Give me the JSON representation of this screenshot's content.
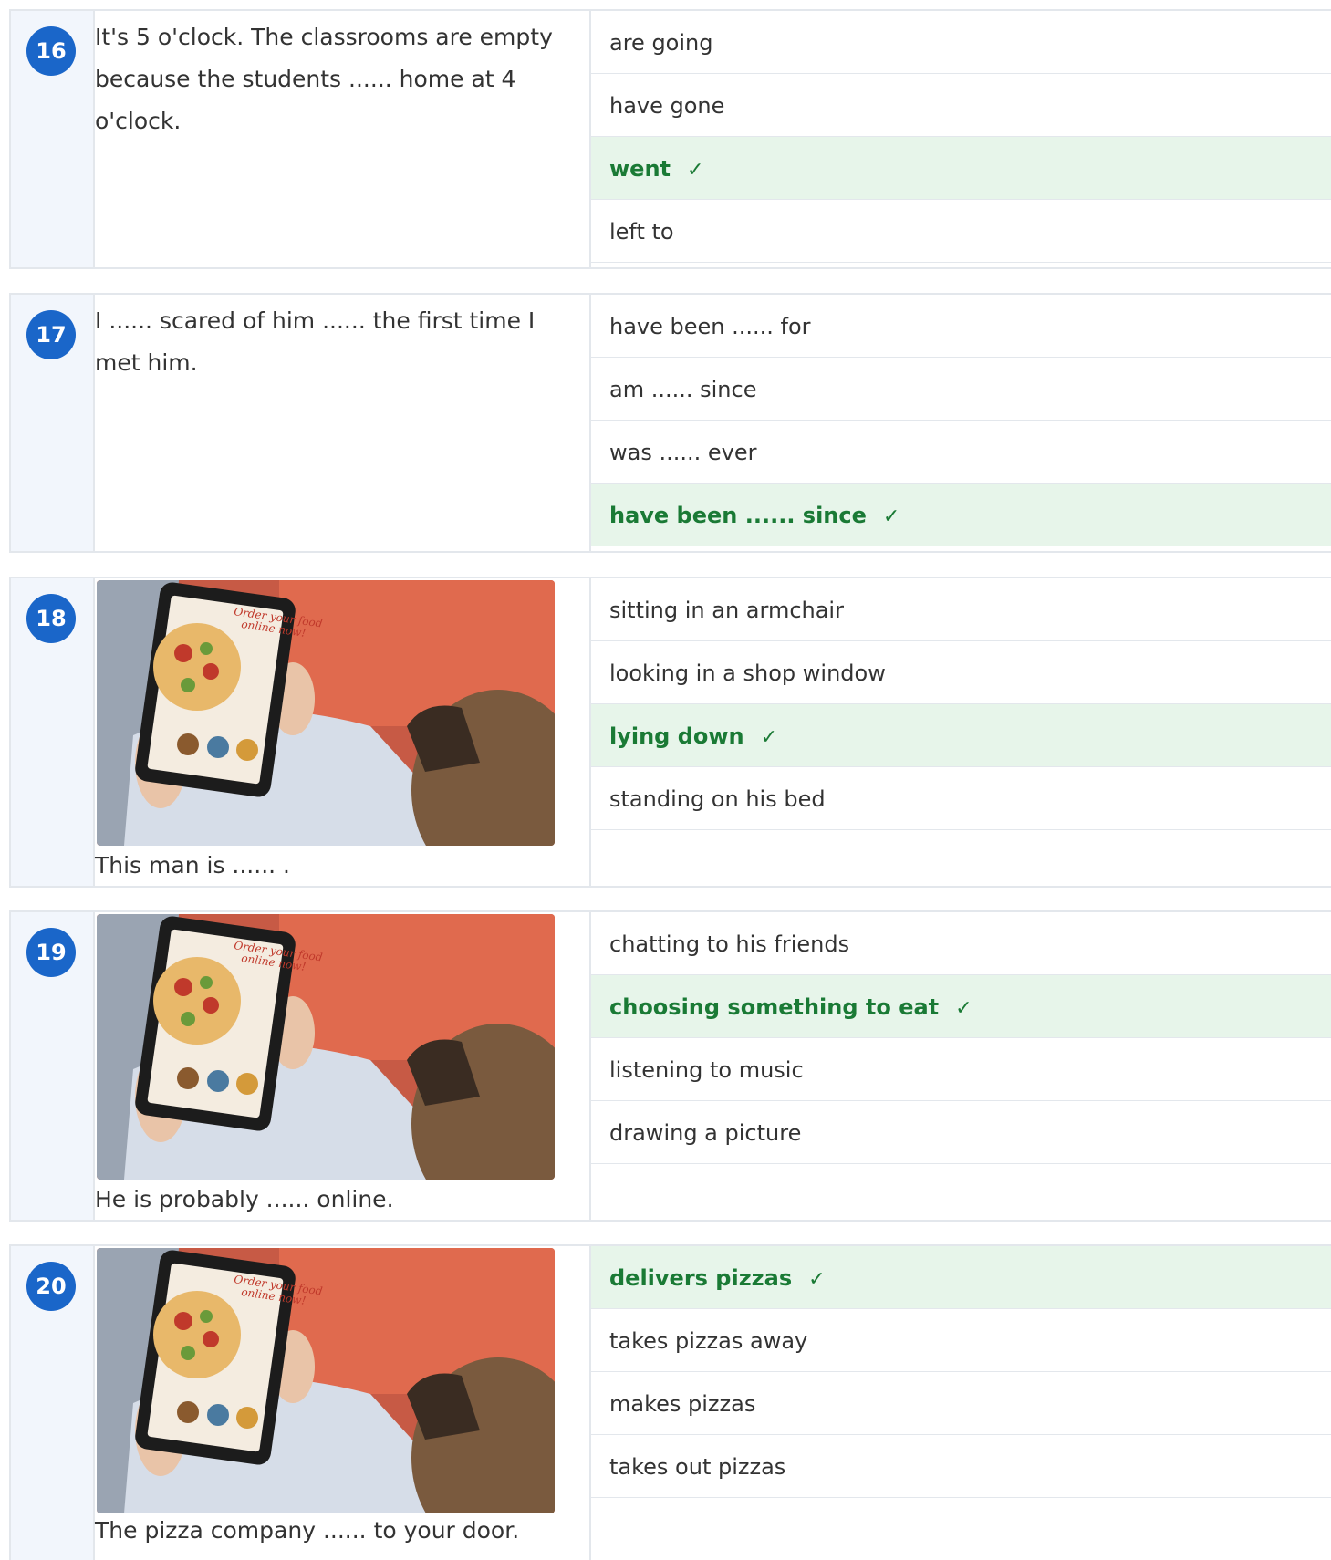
{
  "questions": [
    {
      "number": "16",
      "prompt": "It's 5 o'clock. The classrooms are empty because the students ...... home at 4 o'clock.",
      "has_image": false,
      "options": [
        {
          "label": "are going",
          "correct": false
        },
        {
          "label": "have gone",
          "correct": false
        },
        {
          "label": "went",
          "correct": true
        },
        {
          "label": "left to",
          "correct": false
        }
      ]
    },
    {
      "number": "17",
      "prompt": "I ...... scared of him ...... the first time I met him.",
      "has_image": false,
      "options": [
        {
          "label": "have been ...... for",
          "correct": false
        },
        {
          "label": "am ...... since",
          "correct": false
        },
        {
          "label": "was ...... ever",
          "correct": false
        },
        {
          "label": "have been ...... since",
          "correct": true
        }
      ]
    },
    {
      "number": "18",
      "prompt": "This man is ...... .",
      "has_image": true,
      "image_text": [
        "Order your food",
        "online now!"
      ],
      "options": [
        {
          "label": "sitting in an armchair",
          "correct": false
        },
        {
          "label": "looking in a shop window",
          "correct": false
        },
        {
          "label": "lying down",
          "correct": true
        },
        {
          "label": "standing on his bed",
          "correct": false
        }
      ]
    },
    {
      "number": "19",
      "prompt": "He is probably ...... online.",
      "has_image": true,
      "image_text": [
        "Order your food",
        "online now!"
      ],
      "options": [
        {
          "label": "chatting to his friends",
          "correct": false
        },
        {
          "label": "choosing something to eat",
          "correct": true
        },
        {
          "label": "listening to music",
          "correct": false
        },
        {
          "label": "drawing a picture",
          "correct": false
        }
      ]
    },
    {
      "number": "20",
      "prompt": "The pizza company ...... to your door.",
      "has_image": true,
      "image_text": [
        "Order your food",
        "online now!"
      ],
      "options": [
        {
          "label": "delivers pizzas",
          "correct": true
        },
        {
          "label": "takes pizzas away",
          "correct": false
        },
        {
          "label": "makes pizzas",
          "correct": false
        },
        {
          "label": "takes out pizzas",
          "correct": false
        }
      ]
    }
  ],
  "check_mark": "✓",
  "colors": {
    "badge": "#1a66c9",
    "correct_bg": "#e7f5ea",
    "correct_text": "#1a7a35",
    "number_column_bg": "#f2f6fc",
    "border": "#e3e7ec",
    "couch": "#e06a4e"
  }
}
